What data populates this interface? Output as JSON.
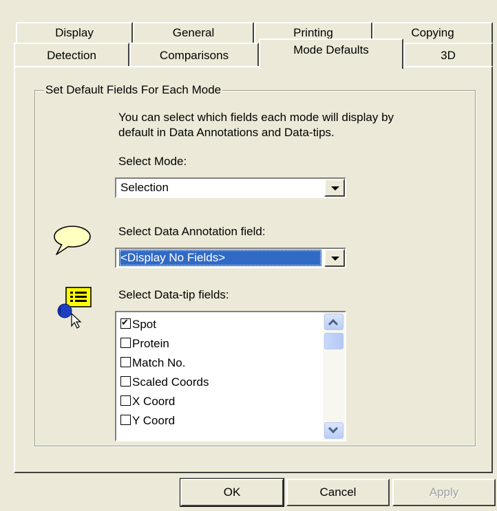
{
  "tabs_back": [
    "Display",
    "General",
    "Printing",
    "Copying"
  ],
  "tabs_front": [
    "Detection",
    "Comparisons",
    "Mode Defaults",
    "3D"
  ],
  "group_label": "Set Default Fields For Each Mode",
  "description_line1": "You can select which fields each mode will display by",
  "description_line2": "default in Data Annotations and Data-tips.",
  "select_mode": {
    "label": "Select Mode:",
    "value": "Selection"
  },
  "annotation": {
    "label": "Select Data Annotation field:",
    "value": "<Display No Fields>"
  },
  "datatip": {
    "label": "Select Data-tip fields:",
    "items": [
      {
        "label": "Spot",
        "checked": true
      },
      {
        "label": "Protein",
        "checked": false
      },
      {
        "label": "Match No.",
        "checked": false
      },
      {
        "label": "Scaled Coords",
        "checked": false
      },
      {
        "label": "X Coord",
        "checked": false
      },
      {
        "label": "Y Coord",
        "checked": false
      }
    ]
  },
  "buttons": {
    "ok": "OK",
    "cancel": "Cancel",
    "apply": "Apply"
  },
  "icons": {
    "annotation": "speech-bubble-icon",
    "datatip": "data-tip-pointer-icon"
  }
}
